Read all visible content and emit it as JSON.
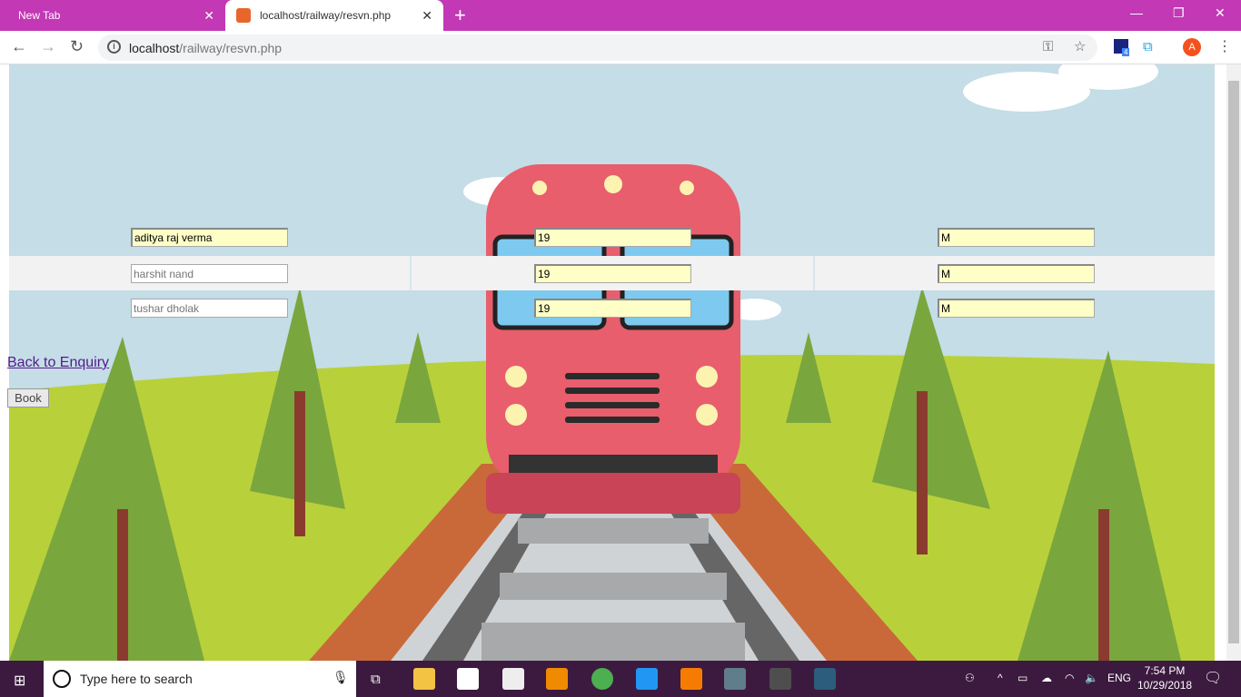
{
  "browser": {
    "tabs": [
      {
        "label": "New Tab",
        "active": false
      },
      {
        "label": "localhost/railway/resvn.php",
        "active": true
      }
    ],
    "url_host": "localhost",
    "url_path": "/railway/resvn.php",
    "profile_initial": "A",
    "extension_badge": "4"
  },
  "passengers": [
    {
      "name": "aditya raj verma",
      "age": "19",
      "gender": "M"
    },
    {
      "name": "harshit nand",
      "age": "19",
      "gender": "M"
    },
    {
      "name": "tushar dholak",
      "age": "19",
      "gender": "M"
    }
  ],
  "back_link": "Back to Enquiry",
  "book_button": "Book",
  "taskbar": {
    "search_placeholder": "Type here to search",
    "language": "ENG",
    "time": "7:54 PM",
    "date": "10/29/2018"
  },
  "colors": {
    "tabbar": "#c238b5",
    "taskbar": "#3c1a3f",
    "highlight_input": "#fdffc7"
  }
}
